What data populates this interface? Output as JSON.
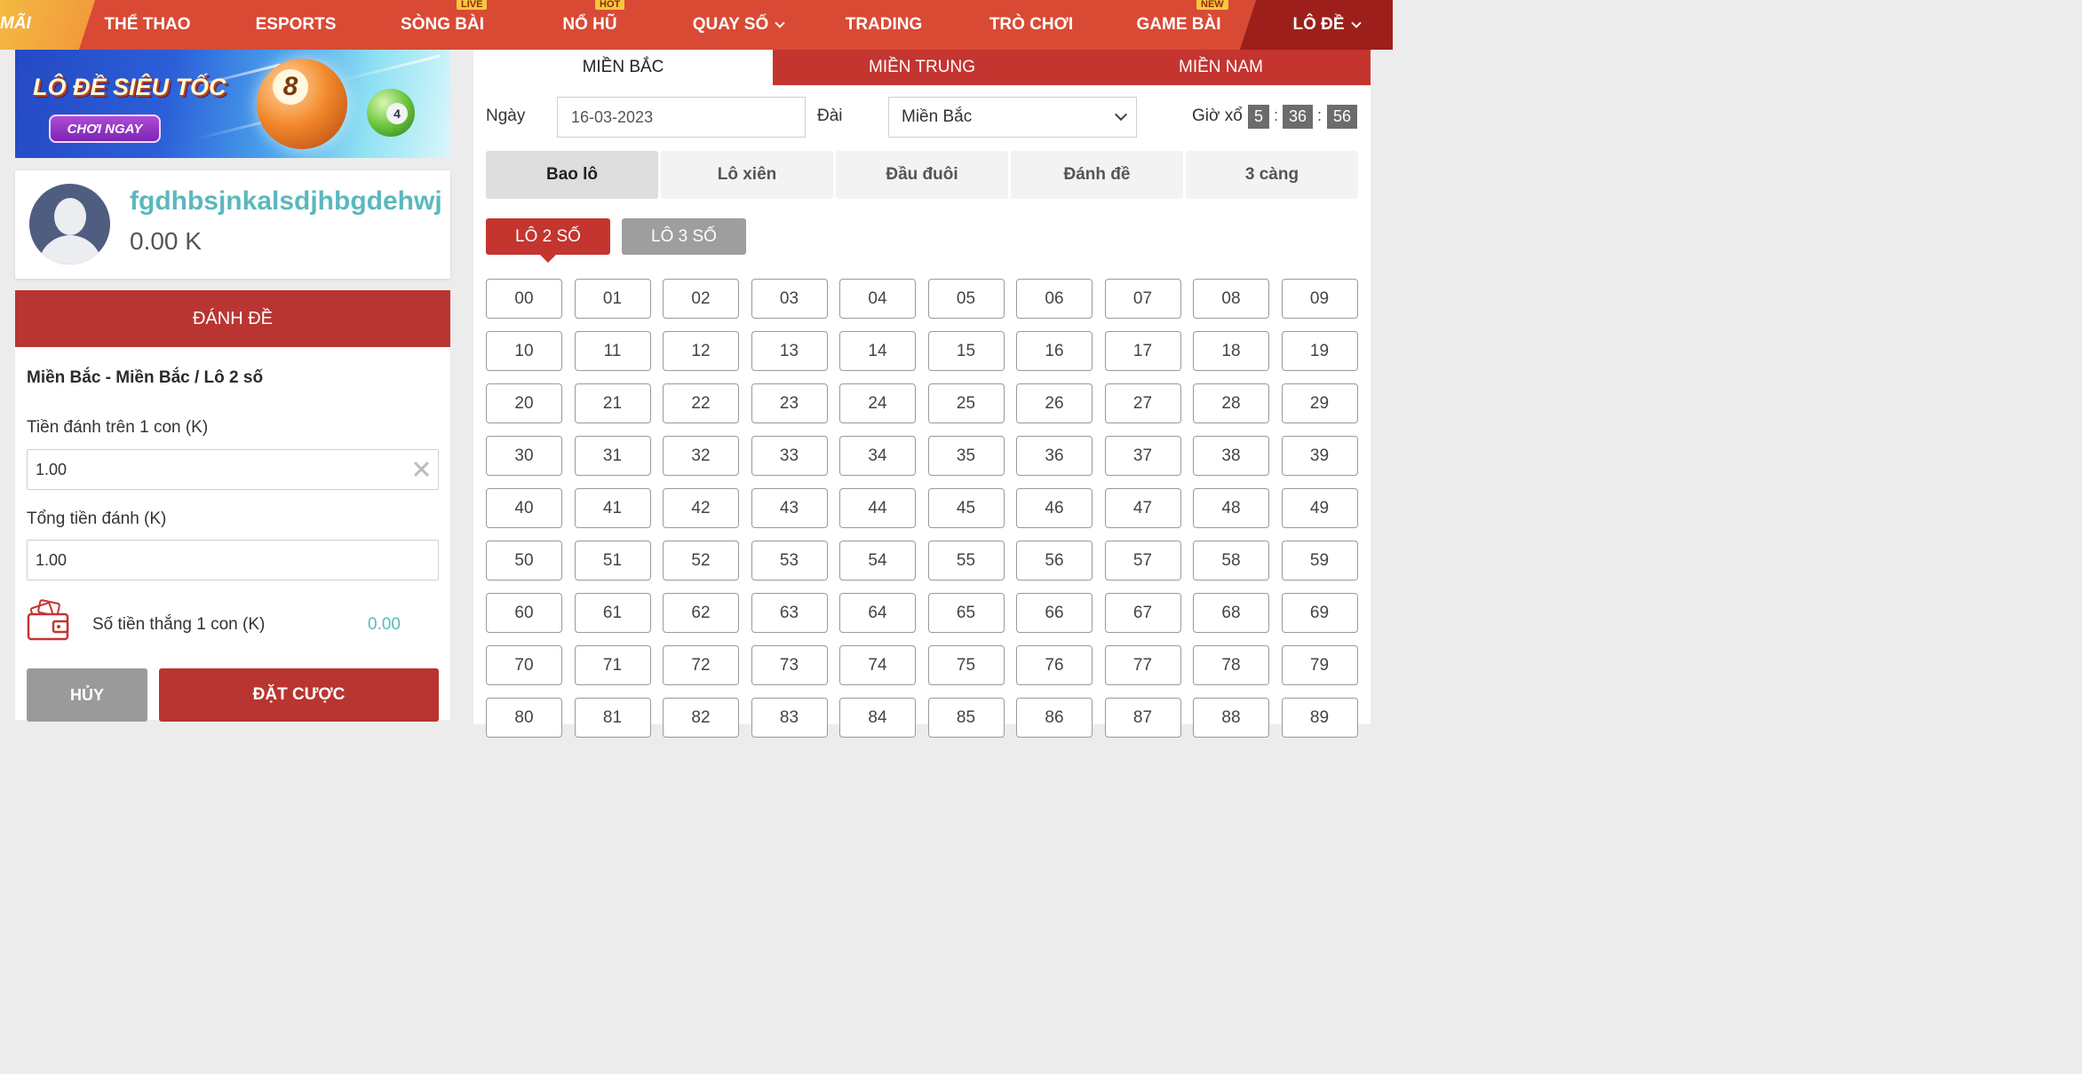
{
  "nav": {
    "promo_label": "MÃI",
    "items": [
      {
        "label": "THỂ THAO",
        "badge": ""
      },
      {
        "label": "ESPORTS",
        "badge": ""
      },
      {
        "label": "SÒNG BÀI",
        "badge": "LIVE"
      },
      {
        "label": "NỔ HŨ",
        "badge": "HOT"
      },
      {
        "label": "QUAY SỐ",
        "badge": ""
      },
      {
        "label": "TRADING",
        "badge": ""
      },
      {
        "label": "TRÒ CHƠI",
        "badge": ""
      },
      {
        "label": "GAME BÀI",
        "badge": "NEW"
      },
      {
        "label": "LÔ ĐỀ",
        "badge": ""
      }
    ]
  },
  "banner": {
    "title": "LÔ ĐỀ SIÊU TỐC",
    "cta": "CHƠI NGAY",
    "ball_big": "8",
    "ball_small": "4"
  },
  "user": {
    "username": "fgdhbsjnkalsdjhbgdehwj",
    "balance": "0.00 K"
  },
  "bet": {
    "header": "ĐÁNH ĐỀ",
    "selection_title": "Miền Bắc - Miền Bắc / Lô 2 số",
    "per_number_label": "Tiền đánh trên 1 con (K)",
    "per_number_value": "1.00",
    "total_label": "Tổng tiền đánh (K)",
    "total_value": "1.00",
    "win_label": "Số tiền thắng 1 con (K)",
    "win_value": "0.00",
    "cancel_label": "HỦY",
    "place_label": "ĐẶT CƯỢC"
  },
  "regions": [
    "MIỀN BẮC",
    "MIỀN TRUNG",
    "MIỀN NAM"
  ],
  "filters": {
    "date_label": "Ngày",
    "date_value": "16-03-2023",
    "station_label": "Đài",
    "station_value": "Miền Bắc",
    "draw_time_label": "Giờ xổ",
    "hours": "5",
    "minutes": "36",
    "seconds": "56"
  },
  "bet_types": [
    "Bao lô",
    "Lô xiên",
    "Đầu đuôi",
    "Đánh đề",
    "3 càng"
  ],
  "sub_types": [
    "LÔ 2 SỐ",
    "LÔ 3 SỐ"
  ],
  "numbers": [
    "00",
    "01",
    "02",
    "03",
    "04",
    "05",
    "06",
    "07",
    "08",
    "09",
    "10",
    "11",
    "12",
    "13",
    "14",
    "15",
    "16",
    "17",
    "18",
    "19",
    "20",
    "21",
    "22",
    "23",
    "24",
    "25",
    "26",
    "27",
    "28",
    "29",
    "30",
    "31",
    "32",
    "33",
    "34",
    "35",
    "36",
    "37",
    "38",
    "39",
    "40",
    "41",
    "42",
    "43",
    "44",
    "45",
    "46",
    "47",
    "48",
    "49",
    "50",
    "51",
    "52",
    "53",
    "54",
    "55",
    "56",
    "57",
    "58",
    "59",
    "60",
    "61",
    "62",
    "63",
    "64",
    "65",
    "66",
    "67",
    "68",
    "69",
    "70",
    "71",
    "72",
    "73",
    "74",
    "75",
    "76",
    "77",
    "78",
    "79",
    "80",
    "81",
    "82",
    "83",
    "84",
    "85",
    "86",
    "87",
    "88",
    "89"
  ],
  "colors": {
    "nav_red": "#d94a35",
    "accent_red": "#b93531",
    "teal": "#5bb8bd",
    "badge_yellow": "#f7c63c"
  }
}
